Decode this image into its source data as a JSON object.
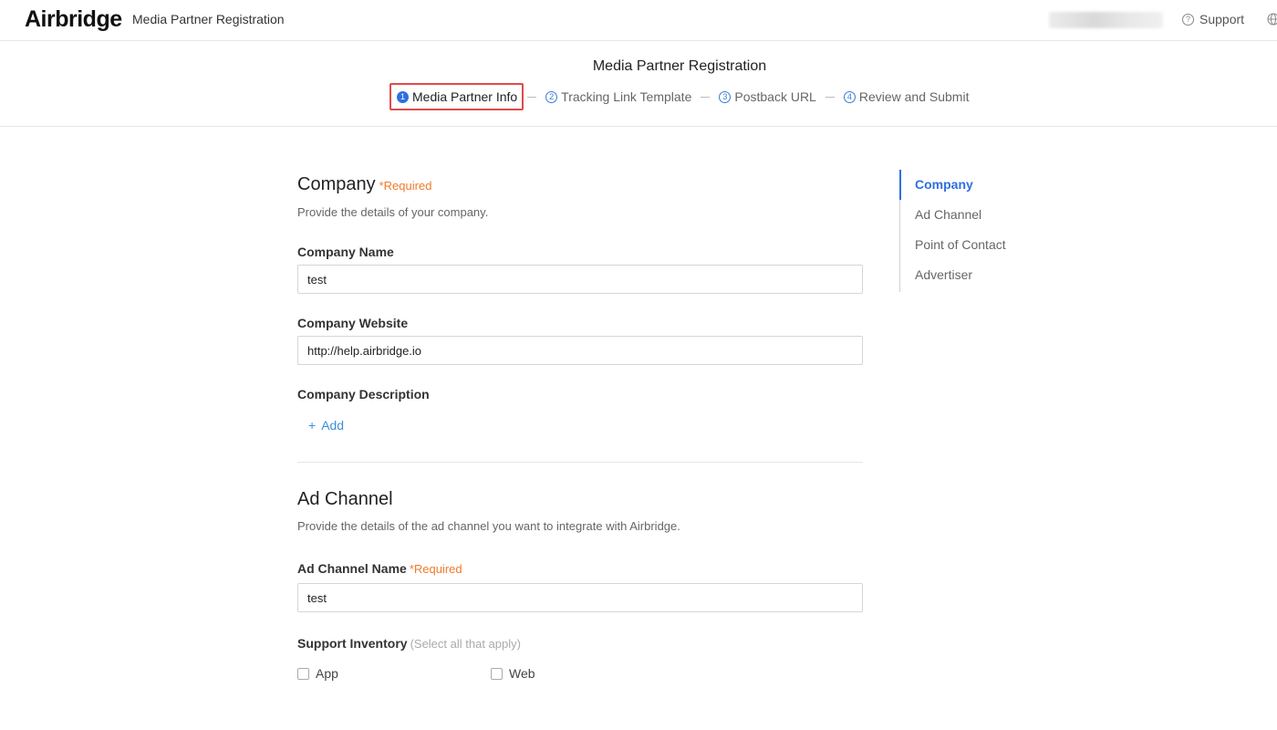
{
  "header": {
    "logo": "Airbridge",
    "app_title": "Media Partner Registration",
    "support_label": "Support"
  },
  "stepper": {
    "title": "Media Partner Registration",
    "steps": [
      {
        "num": "1",
        "label": "Media Partner Info",
        "active": true
      },
      {
        "num": "2",
        "label": "Tracking Link Template",
        "active": false
      },
      {
        "num": "3",
        "label": "Postback URL",
        "active": false
      },
      {
        "num": "4",
        "label": "Review and Submit",
        "active": false
      }
    ]
  },
  "company": {
    "title": "Company",
    "required": "*Required",
    "description": "Provide the details of your company.",
    "name_label": "Company Name",
    "name_value": "test",
    "website_label": "Company Website",
    "website_value": "http://help.airbridge.io",
    "description_label": "Company Description",
    "add_label": "Add"
  },
  "ad_channel": {
    "title": "Ad Channel",
    "description": "Provide the details of the ad channel you want to integrate with Airbridge.",
    "name_label": "Ad Channel Name",
    "name_required": "*Required",
    "name_value": "test",
    "inventory_label": "Support Inventory",
    "inventory_hint": "(Select all that apply)",
    "inventory_options": [
      "App",
      "Web"
    ]
  },
  "toc": {
    "items": [
      "Company",
      "Ad Channel",
      "Point of Contact",
      "Advertiser"
    ],
    "active_index": 0
  },
  "colors": {
    "accent": "#2f6fe0",
    "required": "#f07a2a",
    "highlight_border": "#e04a4a",
    "link": "#3d8fd9"
  }
}
